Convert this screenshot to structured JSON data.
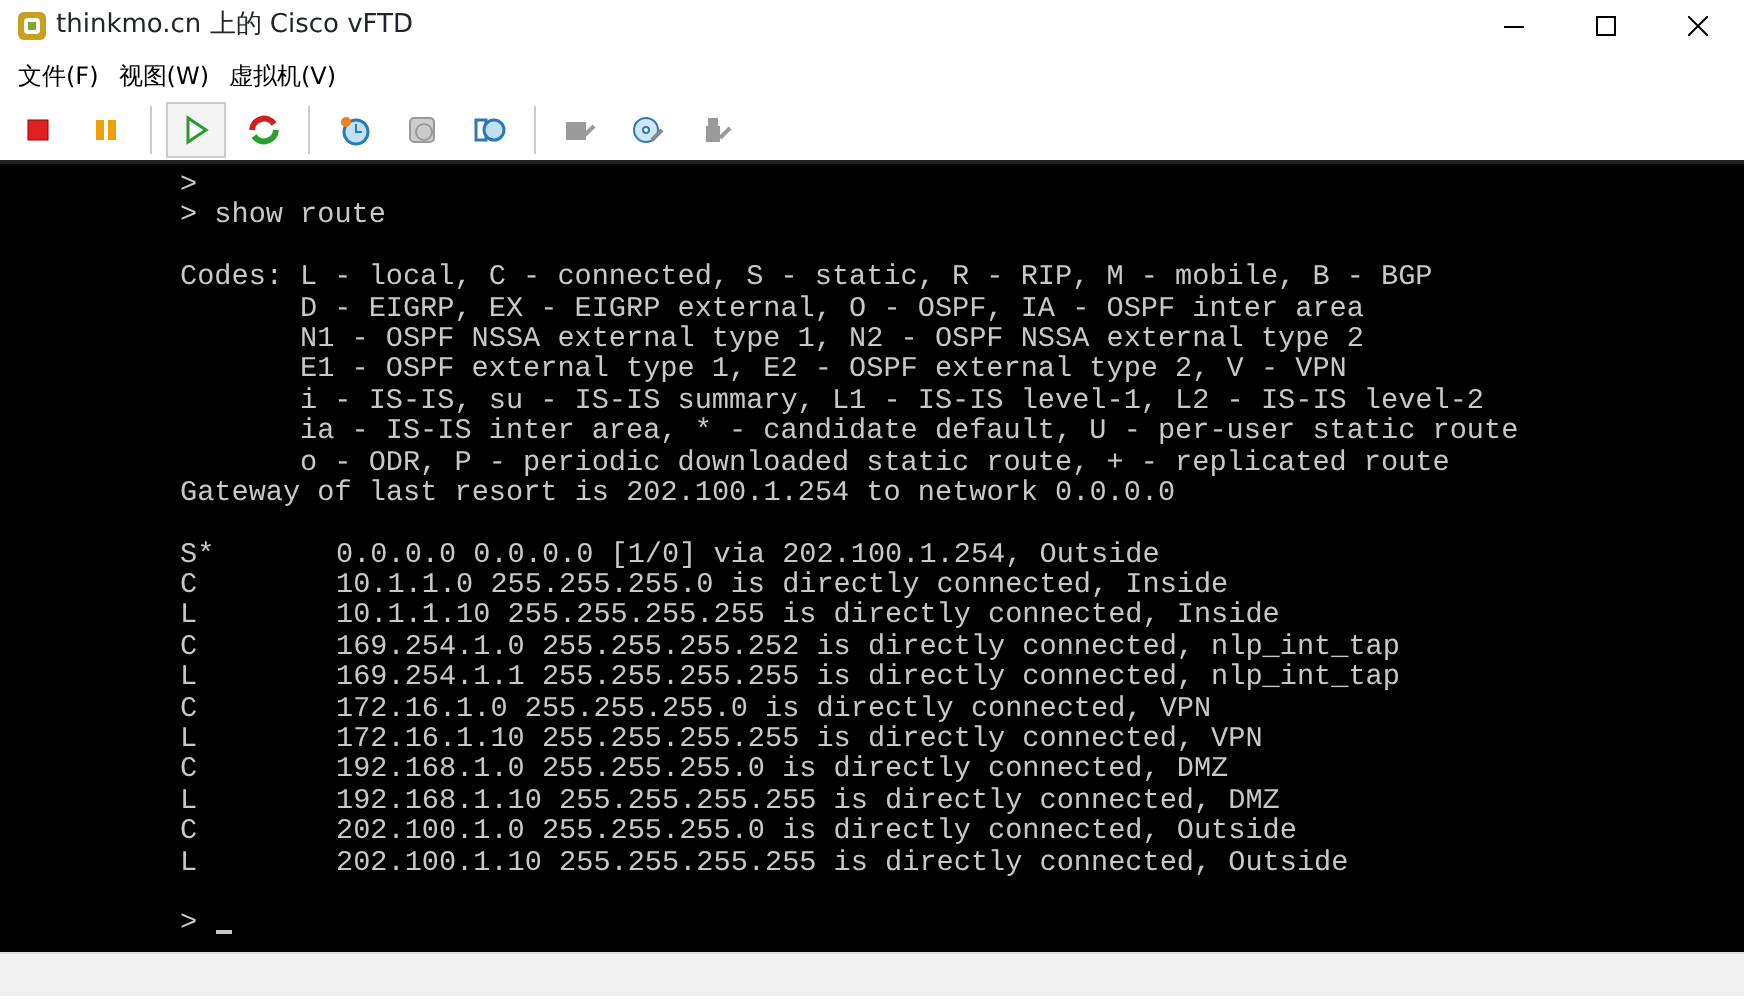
{
  "window": {
    "title": "thinkmo.cn 上的 Cisco vFTD"
  },
  "menu": [
    "文件(F)",
    "视图(W)",
    "虚拟机(V)"
  ],
  "toolbar": [
    [
      {
        "kind": "stop",
        "disabled": false,
        "selected": false
      },
      {
        "kind": "pause",
        "disabled": false,
        "selected": false
      }
    ],
    [
      {
        "kind": "play",
        "disabled": false,
        "selected": true
      },
      {
        "kind": "reset",
        "disabled": false,
        "selected": false
      }
    ],
    [
      {
        "kind": "snapshot",
        "disabled": false,
        "selected": false
      },
      {
        "kind": "snapshot-revert",
        "disabled": true,
        "selected": false
      },
      {
        "kind": "snapshot-manager",
        "disabled": false,
        "selected": false
      }
    ],
    [
      {
        "kind": "device",
        "disabled": true,
        "selected": false
      },
      {
        "kind": "disc",
        "disabled": false,
        "selected": false
      },
      {
        "kind": "usb",
        "disabled": true,
        "selected": false
      }
    ]
  ],
  "console": {
    "history": [
      ">",
      "> show route"
    ],
    "codes": {
      "label": "Codes:",
      "lines": [
        "L - local, C - connected, S - static, R - RIP, M - mobile, B - BGP",
        "D - EIGRP, EX - EIGRP external, O - OSPF, IA - OSPF inter area",
        "N1 - OSPF NSSA external type 1, N2 - OSPF NSSA external type 2",
        "E1 - OSPF external type 1, E2 - OSPF external type 2, V - VPN",
        "i - IS-IS, su - IS-IS summary, L1 - IS-IS level-1, L2 - IS-IS level-2",
        "ia - IS-IS inter area, * - candidate default, U - per-user static route",
        "o - ODR, P - periodic downloaded static route, + - replicated route"
      ]
    },
    "gateway": "Gateway of last resort is 202.100.1.254 to network 0.0.0.0",
    "routes": [
      {
        "code": "S*",
        "text": "0.0.0.0 0.0.0.0 [1/0] via 202.100.1.254, Outside"
      },
      {
        "code": "C",
        "text": "10.1.1.0 255.255.255.0 is directly connected, Inside"
      },
      {
        "code": "L",
        "text": "10.1.1.10 255.255.255.255 is directly connected, Inside"
      },
      {
        "code": "C",
        "text": "169.254.1.0 255.255.255.252 is directly connected, nlp_int_tap"
      },
      {
        "code": "L",
        "text": "169.254.1.1 255.255.255.255 is directly connected, nlp_int_tap"
      },
      {
        "code": "C",
        "text": "172.16.1.0 255.255.255.0 is directly connected, VPN"
      },
      {
        "code": "L",
        "text": "172.16.1.10 255.255.255.255 is directly connected, VPN"
      },
      {
        "code": "C",
        "text": "192.168.1.0 255.255.255.0 is directly connected, DMZ"
      },
      {
        "code": "L",
        "text": "192.168.1.10 255.255.255.255 is directly connected, DMZ"
      },
      {
        "code": "C",
        "text": "202.100.1.0 255.255.255.0 is directly connected, Outside"
      },
      {
        "code": "L",
        "text": "202.100.1.10 255.255.255.255 is directly connected, Outside"
      }
    ],
    "prompt": ">"
  }
}
